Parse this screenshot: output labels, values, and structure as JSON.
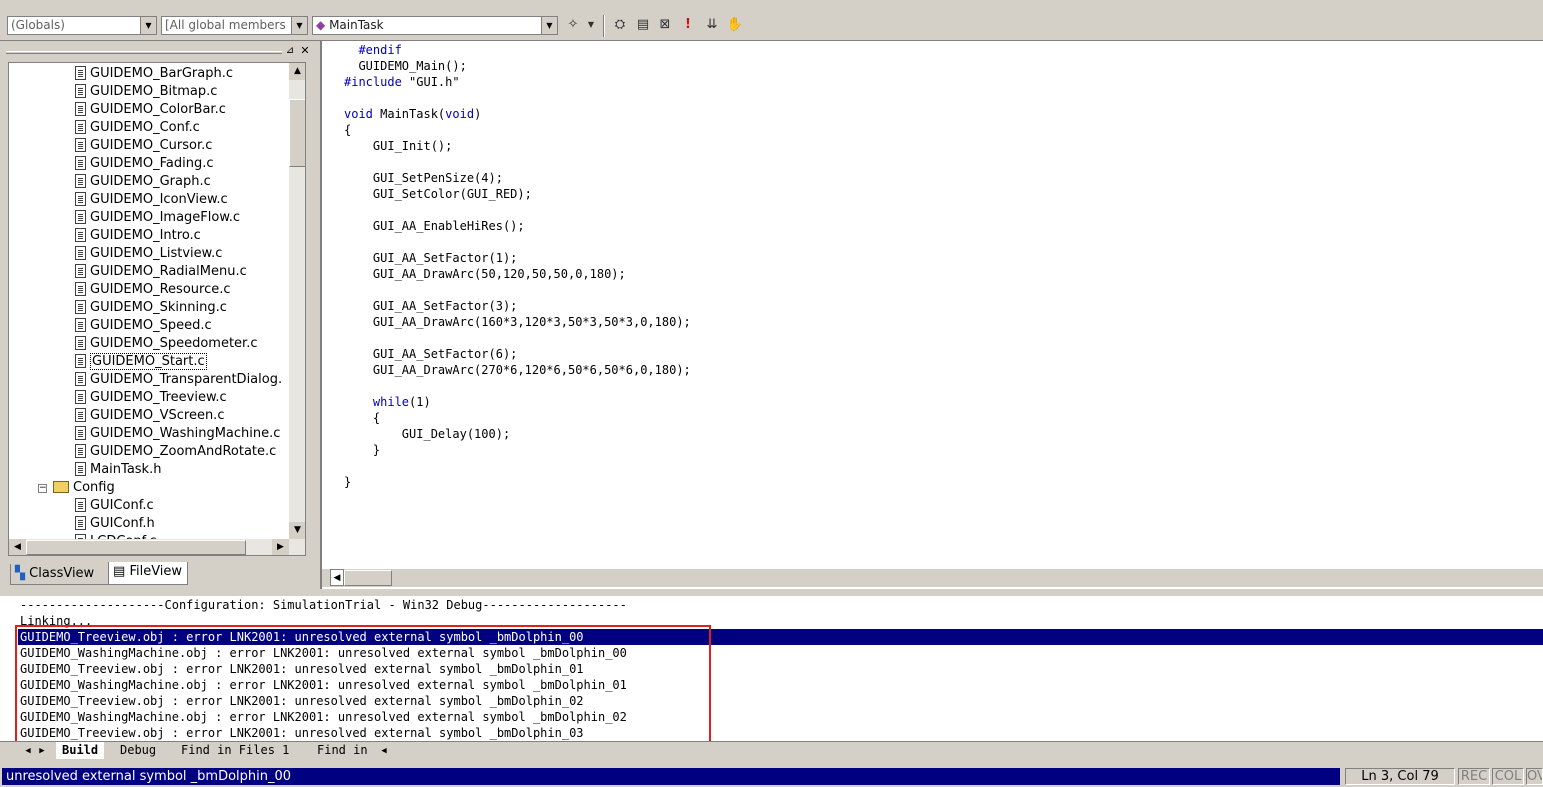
{
  "toolbar": {
    "globals_combo": "(Globals)",
    "members_combo": "[All global members",
    "function_combo": "MainTask"
  },
  "workspace": {
    "files": [
      "GUIDEMO_BarGraph.c",
      "GUIDEMO_Bitmap.c",
      "GUIDEMO_ColorBar.c",
      "GUIDEMO_Conf.c",
      "GUIDEMO_Cursor.c",
      "GUIDEMO_Fading.c",
      "GUIDEMO_Graph.c",
      "GUIDEMO_IconView.c",
      "GUIDEMO_ImageFlow.c",
      "GUIDEMO_Intro.c",
      "GUIDEMO_Listview.c",
      "GUIDEMO_RadialMenu.c",
      "GUIDEMO_Resource.c",
      "GUIDEMO_Skinning.c",
      "GUIDEMO_Speed.c",
      "GUIDEMO_Speedometer.c",
      "GUIDEMO_Start.c",
      "GUIDEMO_TransparentDialog.",
      "GUIDEMO_Treeview.c",
      "GUIDEMO_VScreen.c",
      "GUIDEMO_WashingMachine.c",
      "GUIDEMO_ZoomAndRotate.c",
      "MainTask.h"
    ],
    "selected_file": "GUIDEMO_Start.c",
    "config_folder": "Config",
    "config_files": [
      "GUIConf.c",
      "GUIConf.h",
      "LCDConf.c"
    ],
    "tabs": [
      "ClassView",
      "FileView"
    ]
  },
  "editor": {
    "lines": [
      "  #endif",
      "  GUIDEMO_Main();",
      "#include \"GUI.h\"",
      "",
      "void MainTask(void)",
      "{",
      "    GUI_Init();",
      "",
      "    GUI_SetPenSize(4);",
      "    GUI_SetColor(GUI_RED);",
      "",
      "    GUI_AA_EnableHiRes();",
      "",
      "    GUI_AA_SetFactor(1);",
      "    GUI_AA_DrawArc(50,120,50,50,0,180);",
      "",
      "    GUI_AA_SetFactor(3);",
      "    GUI_AA_DrawArc(160*3,120*3,50*3,50*3,0,180);",
      "",
      "    GUI_AA_SetFactor(6);",
      "    GUI_AA_DrawArc(270*6,120*6,50*6,50*6,0,180);",
      "",
      "    while(1)",
      "    {",
      "        GUI_Delay(100);",
      "    }",
      "",
      "}"
    ]
  },
  "output": {
    "lines": [
      "--------------------Configuration: SimulationTrial - Win32 Debug--------------------",
      "Linking...",
      "GUIDEMO_Treeview.obj : error LNK2001: unresolved external symbol _bmDolphin_00",
      "GUIDEMO_WashingMachine.obj : error LNK2001: unresolved external symbol _bmDolphin_00",
      "GUIDEMO_Treeview.obj : error LNK2001: unresolved external symbol _bmDolphin_01",
      "GUIDEMO_WashingMachine.obj : error LNK2001: unresolved external symbol _bmDolphin_01",
      "GUIDEMO_Treeview.obj : error LNK2001: unresolved external symbol _bmDolphin_02",
      "GUIDEMO_WashingMachine.obj : error LNK2001: unresolved external symbol _bmDolphin_02",
      "GUIDEMO_Treeview.obj : error LNK2001: unresolved external symbol _bmDolphin_03"
    ],
    "tabs": [
      "Build",
      "Debug",
      "Find in Files 1",
      "Find in"
    ]
  },
  "status": {
    "message": "unresolved external symbol _bmDolphin_00",
    "position": "Ln 3, Col 79",
    "rec": "REC",
    "col": "COL",
    "ovr": "OV"
  }
}
